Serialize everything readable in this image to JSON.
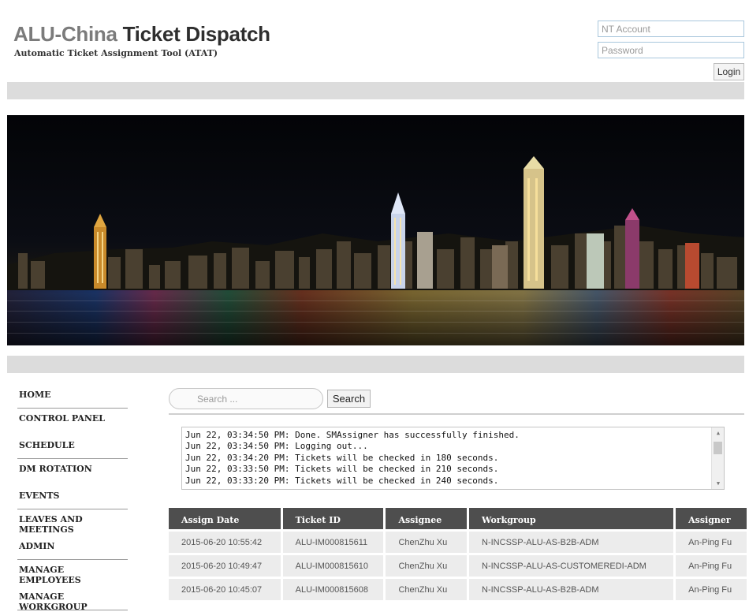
{
  "header": {
    "title_light": "ALU-China",
    "title_dark": "Ticket Dispatch",
    "subtitle": "Automatic Ticket Assignment Tool (ATAT)"
  },
  "login": {
    "account_placeholder": "NT Account",
    "password_placeholder": "Password",
    "button_label": "Login"
  },
  "sidebar": {
    "items": [
      {
        "label": "HOME"
      },
      {
        "label": "CONTROL PANEL"
      },
      {
        "label": "SCHEDULE"
      },
      {
        "label": "DM ROTATION"
      },
      {
        "label": "EVENTS"
      },
      {
        "label": "LEAVES AND MEETINGS"
      },
      {
        "label": "ADMIN"
      },
      {
        "label": "MANAGE EMPLOYEES"
      },
      {
        "label": "MANAGE WORKGROUP"
      }
    ]
  },
  "search": {
    "placeholder": "Search ...",
    "button_label": "Search"
  },
  "log": {
    "lines": [
      "Jun 22, 03:34:50 PM: Done. SMAssigner has successfully finished.",
      "Jun 22, 03:34:50 PM: Logging out...",
      "Jun 22, 03:34:20 PM: Tickets will be checked in 180 seconds.",
      "Jun 22, 03:33:50 PM: Tickets will be checked in 210 seconds.",
      "Jun 22, 03:33:20 PM: Tickets will be checked in 240 seconds."
    ]
  },
  "table": {
    "headers": [
      "Assign Date",
      "Ticket ID",
      "Assignee",
      "Workgroup",
      "Assigner"
    ],
    "rows": [
      [
        "2015-06-20 10:55:42",
        "ALU-IM000815611",
        "ChenZhu Xu",
        "N-INCSSP-ALU-AS-B2B-ADM",
        "An-Ping Fu"
      ],
      [
        "2015-06-20 10:49:47",
        "ALU-IM000815610",
        "ChenZhu Xu",
        "N-INCSSP-ALU-AS-CUSTOMEREDI-ADM",
        "An-Ping Fu"
      ],
      [
        "2015-06-20 10:45:07",
        "ALU-IM000815608",
        "ChenZhu Xu",
        "N-INCSSP-ALU-AS-B2B-ADM",
        "An-Ping Fu"
      ]
    ]
  }
}
